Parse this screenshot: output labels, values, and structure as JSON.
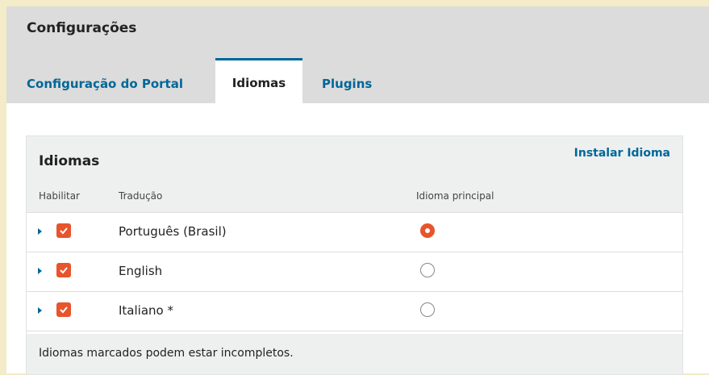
{
  "header": {
    "title": "Configurações",
    "tabs": [
      {
        "label": "Configuração do Portal",
        "active": false
      },
      {
        "label": "Idiomas",
        "active": true
      },
      {
        "label": "Plugins",
        "active": false
      }
    ]
  },
  "panel": {
    "title": "Idiomas",
    "install_link": "Instalar Idioma",
    "columns": {
      "enable": "Habilitar",
      "translation": "Tradução",
      "primary": "Idioma principal"
    },
    "rows": [
      {
        "name": "Português (Brasil)",
        "enabled": true,
        "primary": true
      },
      {
        "name": "English",
        "enabled": true,
        "primary": false
      },
      {
        "name": "Italiano *",
        "enabled": true,
        "primary": false
      }
    ],
    "footer_note": "Idiomas marcados podem estar incompletos."
  },
  "colors": {
    "accent": "#006798",
    "checkbox": "#e8542c",
    "background": "#f4ebc8"
  }
}
